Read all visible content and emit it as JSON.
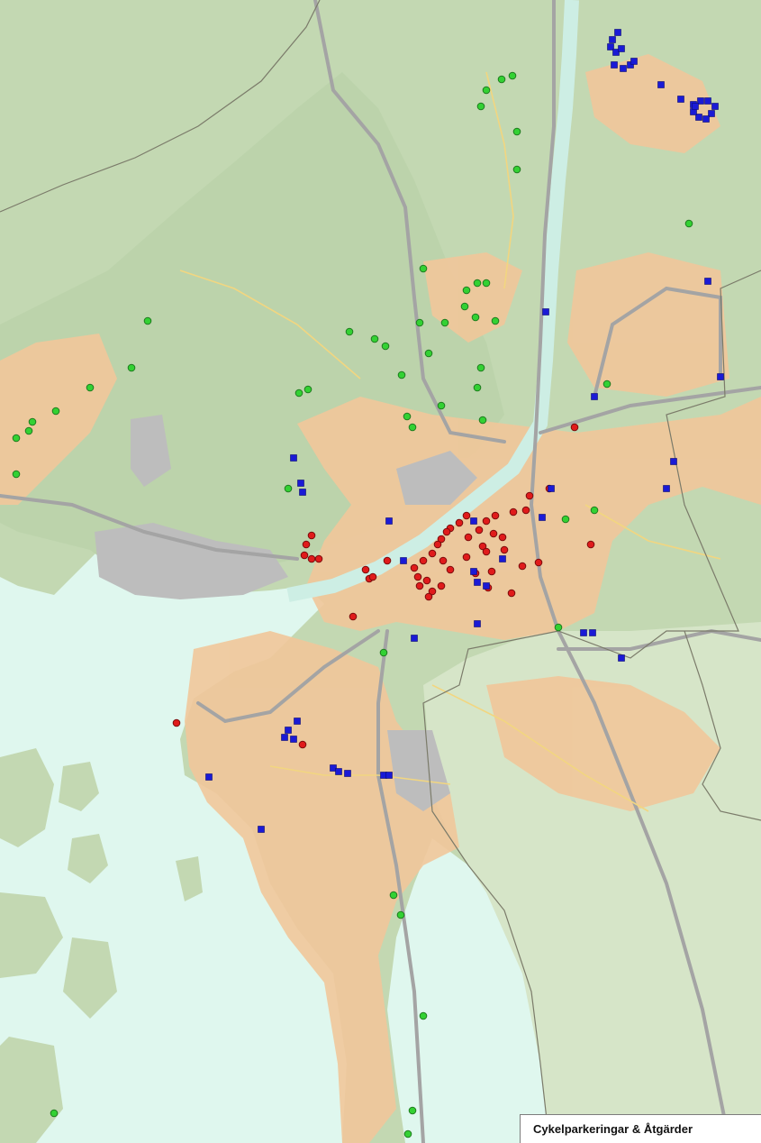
{
  "map": {
    "title": "Cykelparkeringar & Åtgärder",
    "colors": {
      "water": "#dff7ee",
      "forest": "#b9d1a8",
      "forest_light": "#d7e5cb",
      "urban": "#f2c99b",
      "industrial": "#b8b8b8",
      "road_major": "#a8a8a8",
      "road_minor": "#ffffff",
      "road_yellow": "#f3d77a",
      "boundary": "#7b7b6a",
      "river": "#c9efe4"
    },
    "marker_layers": [
      {
        "id": "green",
        "shape": "circle",
        "fill": "#33d133",
        "stroke": "#1e7a1e"
      },
      {
        "id": "red",
        "shape": "circle",
        "fill": "#e01b1b",
        "stroke": "#7a0c0c"
      },
      {
        "id": "blue",
        "shape": "square",
        "fill": "#1a1ad6",
        "stroke": "#0a0a70"
      }
    ]
  }
}
